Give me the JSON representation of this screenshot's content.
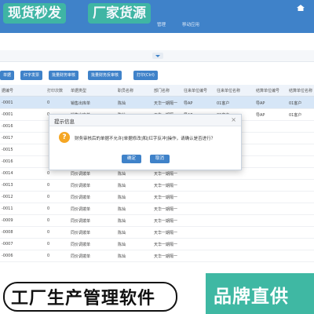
{
  "promo": {
    "left": "现货秒发",
    "right": "厂家货源"
  },
  "nav": {
    "items": [
      "",
      "",
      "",
      "",
      "",
      "",
      "管理",
      "移动应用"
    ]
  },
  "toolbar": {
    "buttons": [
      "单据",
      "红字发票",
      "批量财务审核",
      "批量财务反审核",
      "打印(Ctrl)"
    ]
  },
  "table": {
    "headers": [
      "据编号",
      "打印次数",
      "单据类型",
      "职员名称",
      "部门名称",
      "往来单位编号",
      "往来单位名称",
      "结算单位编号",
      "结算单位名称"
    ],
    "rows": [
      [
        "-0001",
        "0",
        "销售出库单",
        "陈灿",
        "天华一期隔一",
        "导AP",
        "01客户",
        "导AP",
        "01客户"
      ],
      [
        "-0001",
        "0",
        "销售出库单",
        "陈灿",
        "天华一期隔一",
        "导AP",
        "01客户",
        "导AP",
        "01客户"
      ],
      [
        "-0016",
        "",
        "",
        "",
        "",
        "",
        "",
        "",
        ""
      ],
      [
        "-0017",
        "",
        "",
        "",
        "",
        "",
        "",
        "",
        ""
      ],
      [
        "-0015",
        "",
        "",
        "",
        "",
        "",
        "",
        "",
        ""
      ],
      [
        "-0016",
        "",
        "",
        "",
        "",
        "",
        "",
        "",
        ""
      ],
      [
        "-0014",
        "0",
        "同价调拨单",
        "陈灿",
        "天华一期隔一",
        "",
        "",
        "",
        ""
      ],
      [
        "-0013",
        "0",
        "同价调拨单",
        "陈灿",
        "天华一期隔一",
        "",
        "",
        "",
        ""
      ],
      [
        "-0012",
        "0",
        "同价调拨单",
        "陈灿",
        "天华一期隔一",
        "",
        "",
        "",
        ""
      ],
      [
        "-0011",
        "0",
        "同价调拨单",
        "陈灿",
        "天华一期隔一",
        "",
        "",
        "",
        ""
      ],
      [
        "-0009",
        "0",
        "同价调拨单",
        "陈灿",
        "天华一期隔一",
        "",
        "",
        "",
        ""
      ],
      [
        "-0008",
        "0",
        "同价调拨单",
        "陈灿",
        "天华一期隔一",
        "",
        "",
        "",
        ""
      ],
      [
        "-0007",
        "0",
        "同价调拨单",
        "陈灿",
        "天华一期隔一",
        "",
        "",
        "",
        ""
      ],
      [
        "-0006",
        "0",
        "同价调拨单",
        "陈灿",
        "天华一期隔一",
        "",
        "",
        "",
        ""
      ]
    ]
  },
  "dialog": {
    "title": "提示信息",
    "message": "财务审核后的单据不允许[单据修改]和[红字反冲]操作，请确认是否进行？",
    "confirm": "确定",
    "cancel": "取消"
  },
  "banner": {
    "left": "工厂生产管理软件",
    "right": "品牌直供"
  },
  "colors": {
    "primary": "#3f82c9",
    "promo": "#3fb8a3",
    "warning": "#f5a623"
  }
}
